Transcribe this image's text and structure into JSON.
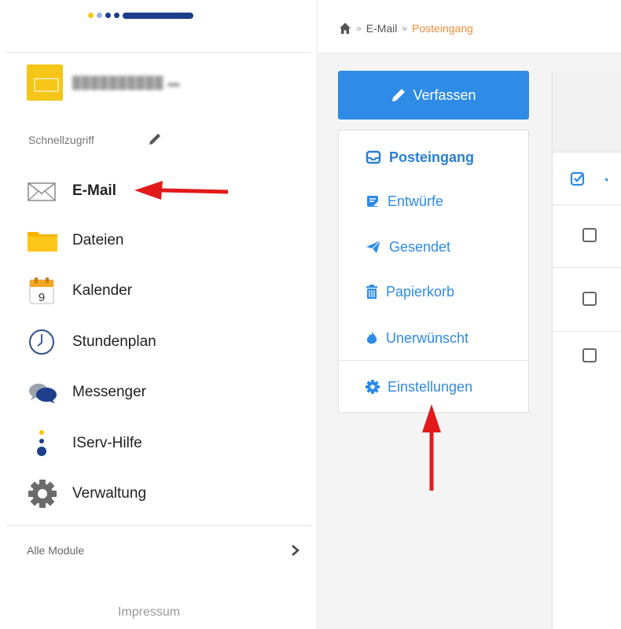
{
  "colors": {
    "accent": "#2e8be6",
    "breadcrumb_current": "#f08c3a",
    "arrow": "#e11b1b",
    "logo_dark": "#1d3f8c",
    "logo_yellow": "#f5c518"
  },
  "sidebar": {
    "quick_access_label": "Schnellzugriff",
    "items": [
      {
        "label": "E-Mail",
        "icon": "envelope-icon"
      },
      {
        "label": "Dateien",
        "icon": "folder-icon"
      },
      {
        "label": "Kalender",
        "icon": "calendar-icon",
        "icon_text": "9"
      },
      {
        "label": "Stundenplan",
        "icon": "clock-icon"
      },
      {
        "label": "Messenger",
        "icon": "chat-bubbles-icon"
      },
      {
        "label": "IServ-Hilfe",
        "icon": "help-icon"
      },
      {
        "label": "Verwaltung",
        "icon": "gear-icon"
      }
    ],
    "all_modules_label": "Alle Module",
    "footer_link": "Impressum"
  },
  "breadcrumb": {
    "items": [
      "E-Mail",
      "Posteingang"
    ],
    "separator": "»"
  },
  "mail": {
    "compose_label": "Verfassen",
    "folders": [
      {
        "label": "Posteingang",
        "icon": "inbox-icon"
      },
      {
        "label": "Entwürfe",
        "icon": "draft-icon"
      },
      {
        "label": "Gesendet",
        "icon": "paper-plane-icon"
      },
      {
        "label": "Papierkorb",
        "icon": "trash-icon"
      },
      {
        "label": "Unerwünscht",
        "icon": "fire-icon"
      }
    ],
    "settings_label": "Einstellungen"
  }
}
